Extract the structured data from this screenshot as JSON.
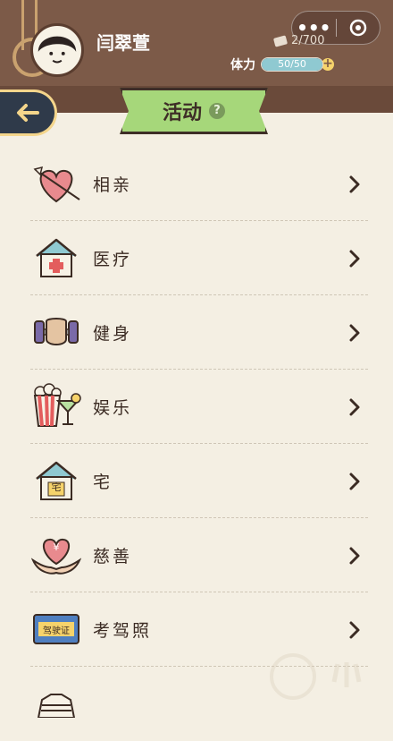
{
  "player": {
    "name": "闫翠萱"
  },
  "currency": {
    "value": "2/700"
  },
  "stamina": {
    "label": "体力",
    "current": 50,
    "max": 50,
    "text": "50/50"
  },
  "title": {
    "text": "活动"
  },
  "items": [
    {
      "label": "相亲",
      "icon": "heart-arrow-icon"
    },
    {
      "label": "医疗",
      "icon": "hospital-icon"
    },
    {
      "label": "健身",
      "icon": "dumbbell-icon"
    },
    {
      "label": "娱乐",
      "icon": "popcorn-cocktail-icon"
    },
    {
      "label": "宅",
      "icon": "house-icon",
      "icon_text": "宅"
    },
    {
      "label": "慈善",
      "icon": "charity-heart-icon",
      "icon_text": "¥"
    },
    {
      "label": "考驾照",
      "icon": "driver-license-icon",
      "icon_text": "驾驶证"
    }
  ],
  "colors": {
    "header": "#7c5a48",
    "banner": "#a6d77a",
    "background": "#f4efe3",
    "back_button": "#2f3a4a",
    "stamina_fill": "#8fc9d1"
  }
}
